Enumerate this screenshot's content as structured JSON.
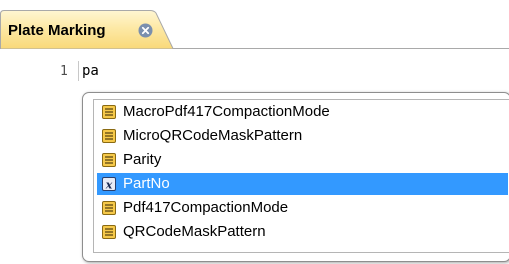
{
  "tab": {
    "title": "Plate Marking",
    "active": true
  },
  "editor": {
    "line_number": "1",
    "text": "pa"
  },
  "autocomplete": {
    "items": [
      {
        "label": "MacroPdf417CompactionMode",
        "icon": "enum-icon",
        "selected": false
      },
      {
        "label": "MicroQRCodeMaskPattern",
        "icon": "enum-icon",
        "selected": false
      },
      {
        "label": "Parity",
        "icon": "enum-icon",
        "selected": false
      },
      {
        "label": "PartNo",
        "icon": "variable-icon",
        "selected": true
      },
      {
        "label": "Pdf417CompactionMode",
        "icon": "enum-icon",
        "selected": false
      },
      {
        "label": "QRCodeMaskPattern",
        "icon": "enum-icon",
        "selected": false
      }
    ],
    "selection_color": "#3399ff"
  },
  "colors": {
    "tab_fill": "#fde8a4",
    "close_button": "#7a8fae"
  }
}
